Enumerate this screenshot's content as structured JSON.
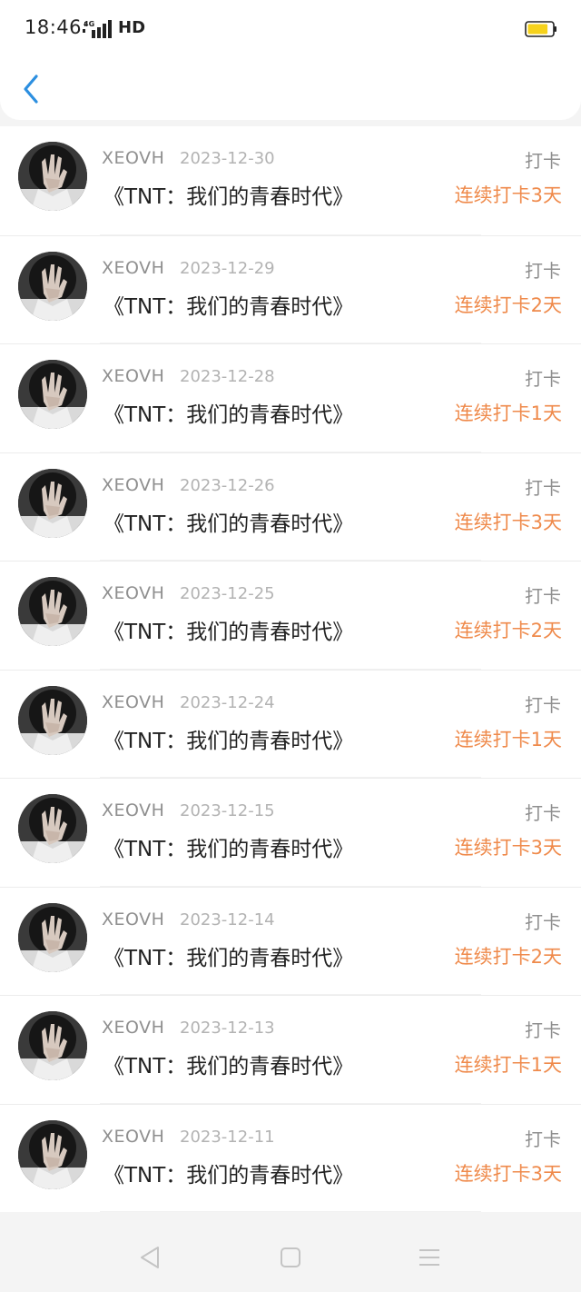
{
  "status_bar": {
    "time": "18:46",
    "network": "4G",
    "hd": "HD",
    "battery_level": 0.8,
    "battery_color": "#f6d21b"
  },
  "nav": {
    "back_icon": "chevron-left-icon",
    "back_color": "#2c8fe0"
  },
  "records": [
    {
      "user": "XEOVH",
      "date": "2023-12-30",
      "title": "《TNT：我们的青春时代》",
      "action": "打卡",
      "streak": "连续打卡3天"
    },
    {
      "user": "XEOVH",
      "date": "2023-12-29",
      "title": "《TNT：我们的青春时代》",
      "action": "打卡",
      "streak": "连续打卡2天"
    },
    {
      "user": "XEOVH",
      "date": "2023-12-28",
      "title": "《TNT：我们的青春时代》",
      "action": "打卡",
      "streak": "连续打卡1天"
    },
    {
      "user": "XEOVH",
      "date": "2023-12-26",
      "title": "《TNT：我们的青春时代》",
      "action": "打卡",
      "streak": "连续打卡3天"
    },
    {
      "user": "XEOVH",
      "date": "2023-12-25",
      "title": "《TNT：我们的青春时代》",
      "action": "打卡",
      "streak": "连续打卡2天"
    },
    {
      "user": "XEOVH",
      "date": "2023-12-24",
      "title": "《TNT：我们的青春时代》",
      "action": "打卡",
      "streak": "连续打卡1天"
    },
    {
      "user": "XEOVH",
      "date": "2023-12-15",
      "title": "《TNT：我们的青春时代》",
      "action": "打卡",
      "streak": "连续打卡3天"
    },
    {
      "user": "XEOVH",
      "date": "2023-12-14",
      "title": "《TNT：我们的青春时代》",
      "action": "打卡",
      "streak": "连续打卡2天"
    },
    {
      "user": "XEOVH",
      "date": "2023-12-13",
      "title": "《TNT：我们的青春时代》",
      "action": "打卡",
      "streak": "连续打卡1天"
    },
    {
      "user": "XEOVH",
      "date": "2023-12-11",
      "title": "《TNT：我们的青春时代》",
      "action": "打卡",
      "streak": "连续打卡3天"
    }
  ],
  "colors": {
    "accent": "#ef8a4b",
    "muted": "#8f8f8f",
    "date": "#b3b3b3",
    "text": "#222222"
  },
  "system_nav": {
    "back_icon": "triangle-back-icon",
    "home_icon": "square-home-icon",
    "menu_icon": "menu-lines-icon"
  }
}
